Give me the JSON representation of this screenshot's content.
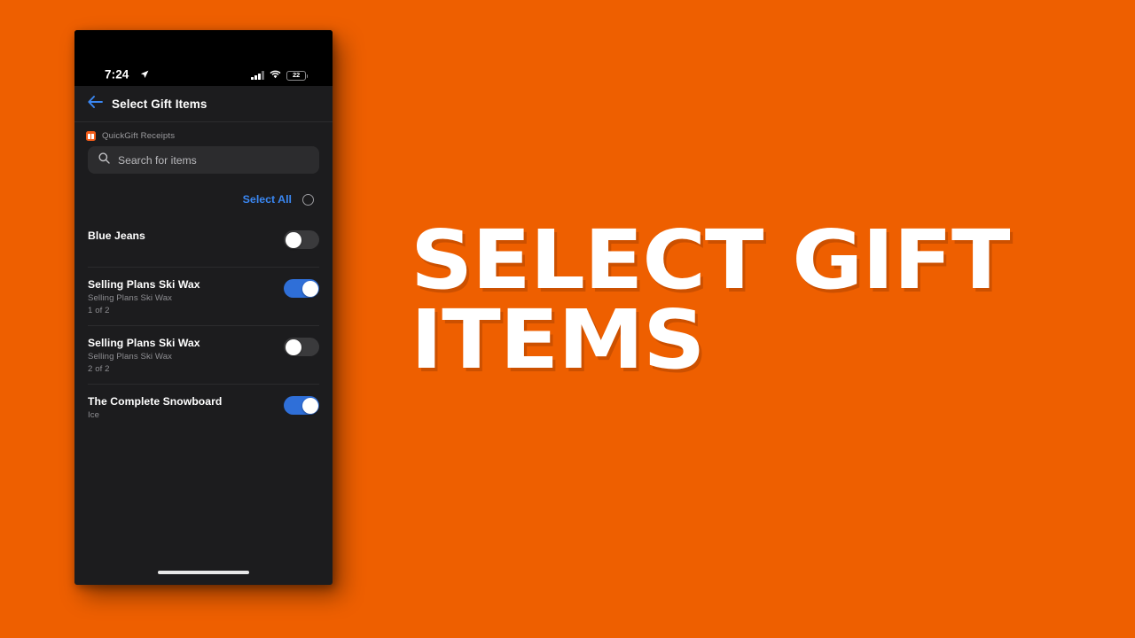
{
  "background_color": "#ee5f00",
  "caption": {
    "text": "Select Gift\nItems",
    "color": "#ffffff"
  },
  "phone": {
    "status_bar": {
      "time": "7:24",
      "location_icon": "location-arrow-icon",
      "signal_icon": "cellular-signal-icon",
      "wifi_icon": "wifi-icon",
      "battery_percent": "22"
    },
    "nav": {
      "back_icon": "back-arrow-icon",
      "title": "Select Gift Items",
      "back_color": "#3a87f2"
    },
    "app_label": {
      "icon": "quickgift-app-icon",
      "icon_color": "#f25c19",
      "text": "QuickGift Receipts"
    },
    "search": {
      "icon": "search-icon",
      "placeholder": "Search for items",
      "value": ""
    },
    "select_all": {
      "label": "Select All",
      "label_color": "#3a87f2",
      "checked": false
    },
    "items": [
      {
        "title": "Blue Jeans",
        "subtitle": "",
        "meta": "",
        "toggle_on": false
      },
      {
        "title": "Selling Plans Ski Wax",
        "subtitle": "Selling Plans Ski Wax",
        "meta": "1 of 2",
        "toggle_on": true
      },
      {
        "title": "Selling Plans Ski Wax",
        "subtitle": "Selling Plans Ski Wax",
        "meta": "2 of 2",
        "toggle_on": false
      },
      {
        "title": "The Complete Snowboard",
        "subtitle": "Ice",
        "meta": "",
        "toggle_on": true
      }
    ],
    "home_indicator": "home-indicator",
    "toggle_on_color": "#2f6fd8",
    "toggle_off_color": "#3a3a3c"
  }
}
